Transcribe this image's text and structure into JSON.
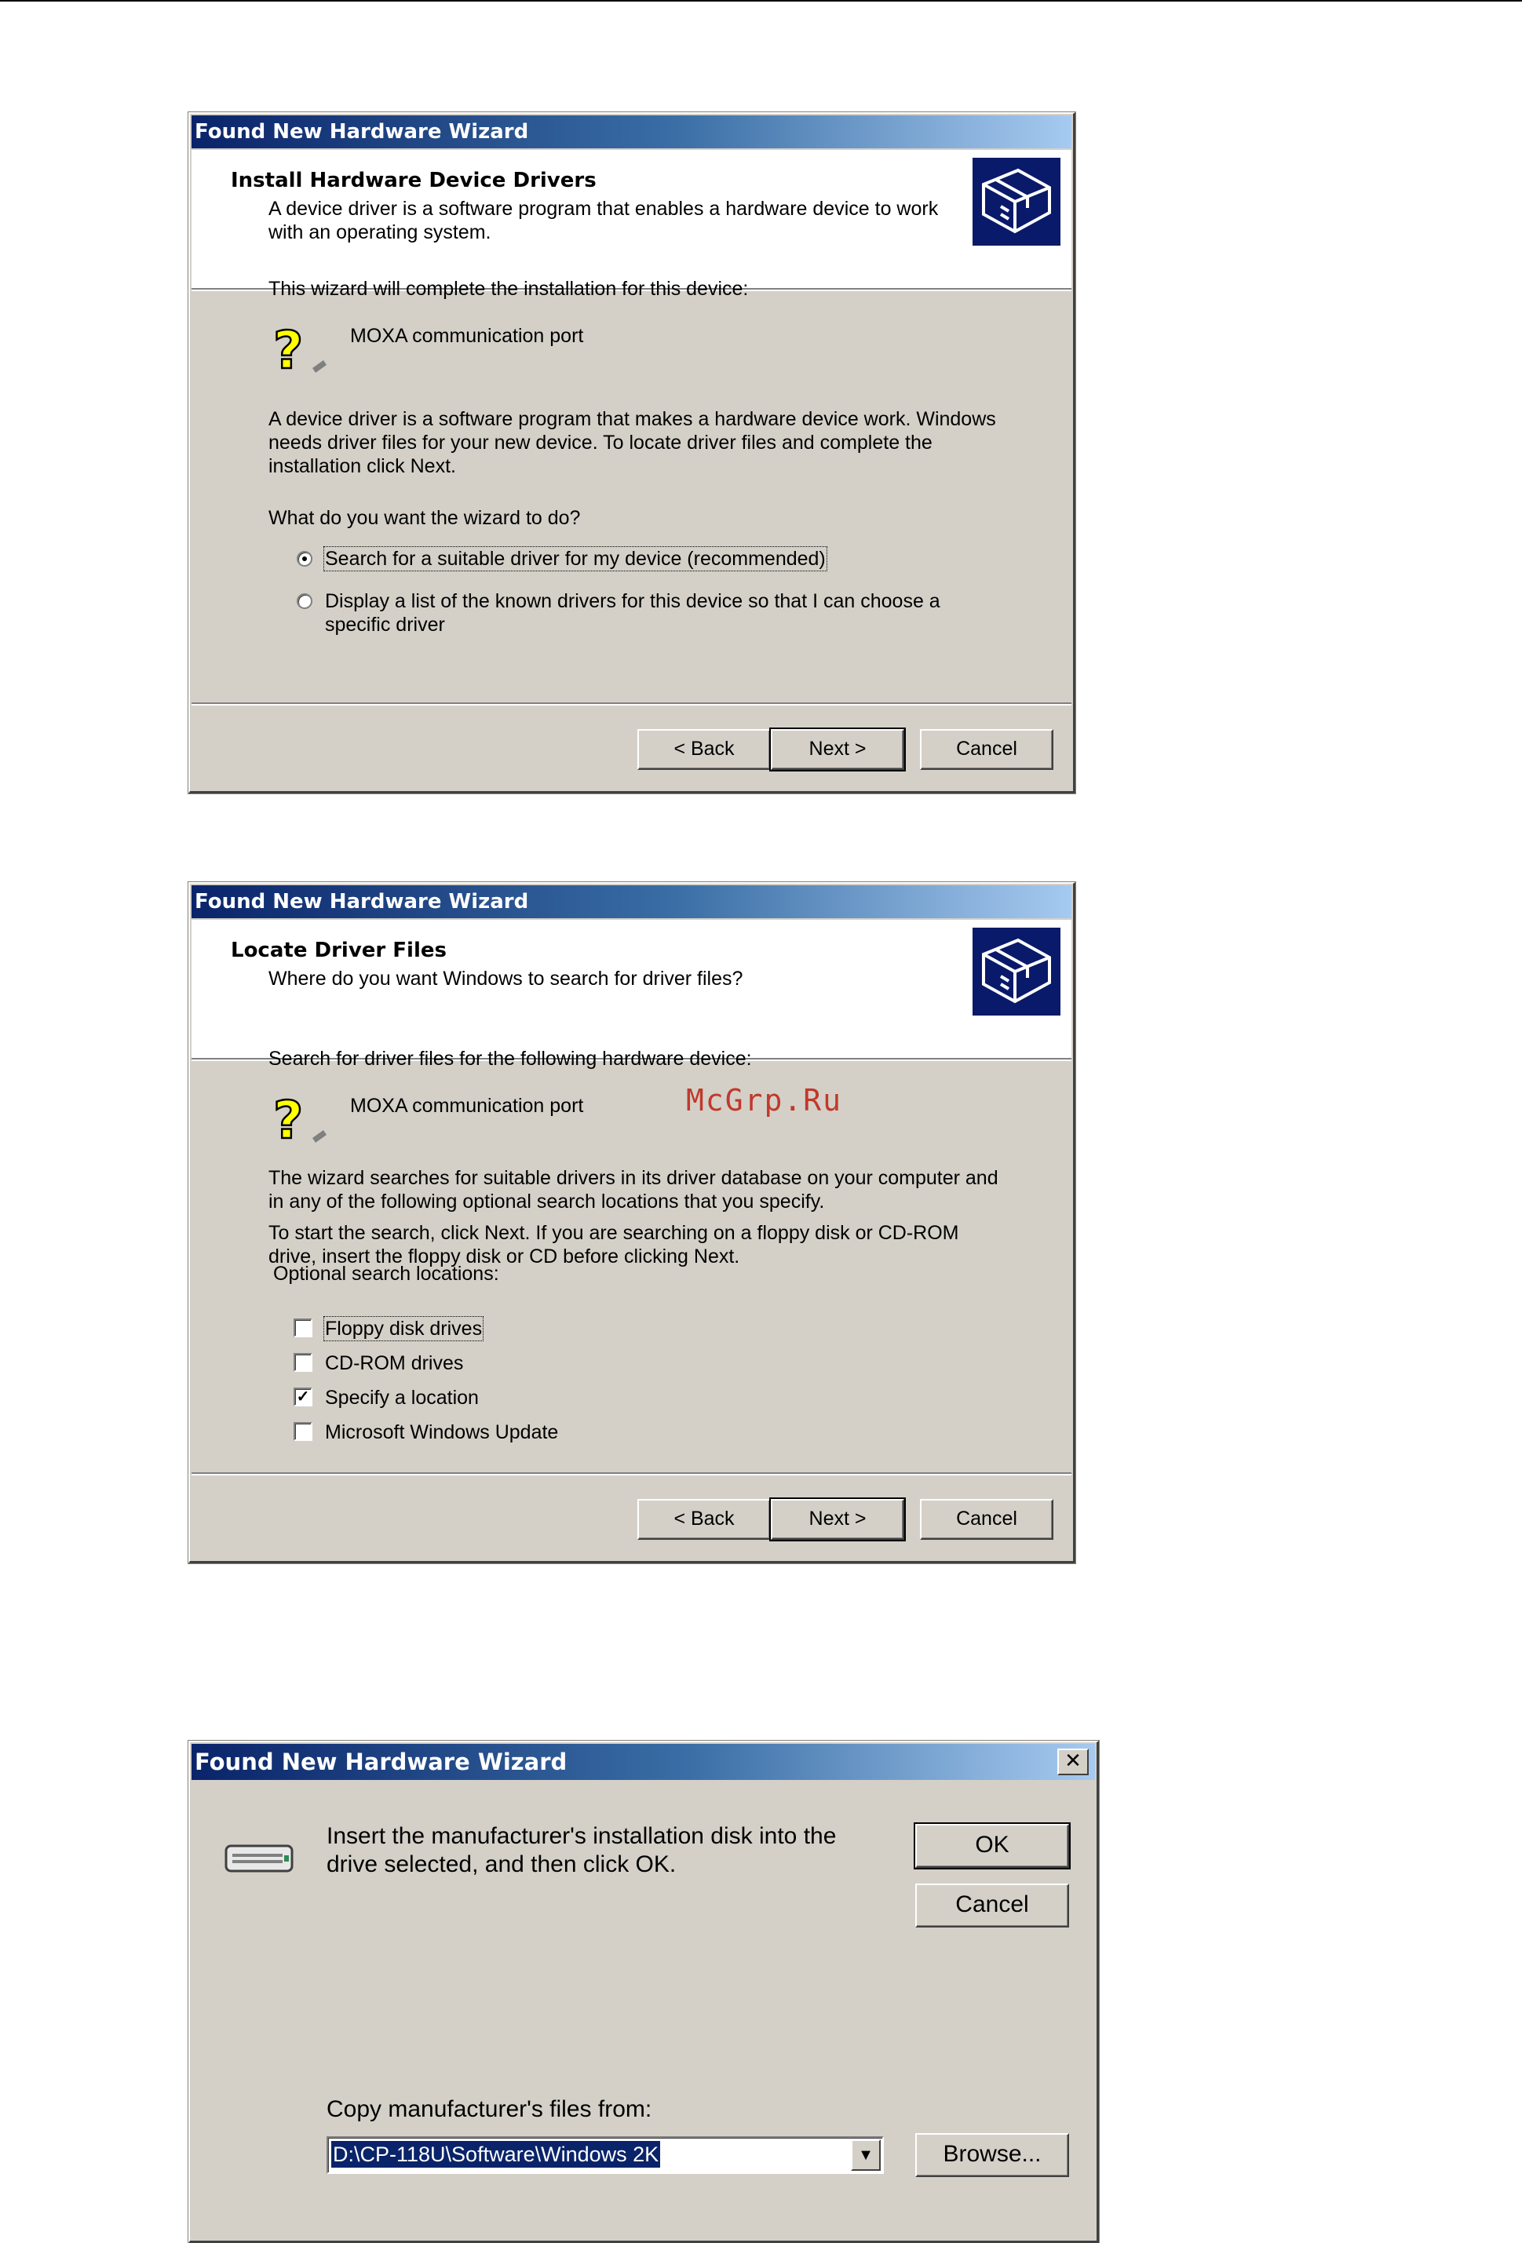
{
  "wizard1": {
    "title": "Found New Hardware Wizard",
    "header_title": "Install Hardware Device Drivers",
    "header_sub": "A device driver is a software program that enables a hardware device to work with an operating system.",
    "intro": "This wizard will complete the installation for this device:",
    "device_name": "MOXA communication port",
    "description": "A device driver is a software program that makes a hardware device work. Windows needs driver files for your new device. To locate driver files and complete the installation click Next.",
    "question": "What do you want the wizard to do?",
    "options": [
      {
        "label": "Search for a suitable driver for my device (recommended)",
        "selected": true
      },
      {
        "label": "Display a list of the known drivers for this device so that I can choose a specific driver",
        "selected": false
      }
    ],
    "back_label": "< Back",
    "next_label": "Next >",
    "cancel_label": "Cancel"
  },
  "wizard2": {
    "title": "Found New Hardware Wizard",
    "header_title": "Locate Driver Files",
    "header_sub": "Where do you want Windows to search for driver files?",
    "intro": "Search for driver files for the following hardware device:",
    "device_name": "MOXA communication port",
    "watermark": "McGrp.Ru",
    "para1": "The wizard searches for suitable drivers in its driver database on your computer and in any of the following optional search locations that you specify.",
    "para2": "To start the search, click Next. If you are searching on a floppy disk or CD-ROM drive, insert the floppy disk or CD before clicking Next.",
    "locations_label": "Optional search locations:",
    "locations": [
      {
        "label": "Floppy disk drives",
        "checked": false
      },
      {
        "label": "CD-ROM drives",
        "checked": false
      },
      {
        "label": "Specify a location",
        "checked": true
      },
      {
        "label": "Microsoft Windows Update",
        "checked": false
      }
    ],
    "back_label": "< Back",
    "next_label": "Next >",
    "cancel_label": "Cancel"
  },
  "dialog3": {
    "title": "Found New Hardware Wizard",
    "close_glyph": "✕",
    "message": "Insert the manufacturer's installation disk into the drive selected, and then click OK.",
    "ok_label": "OK",
    "cancel_label": "Cancel",
    "copy_label": "Copy manufacturer's files from:",
    "path_value": "D:\\CP-118U\\Software\\Windows 2K",
    "browse_label": "Browse..."
  }
}
